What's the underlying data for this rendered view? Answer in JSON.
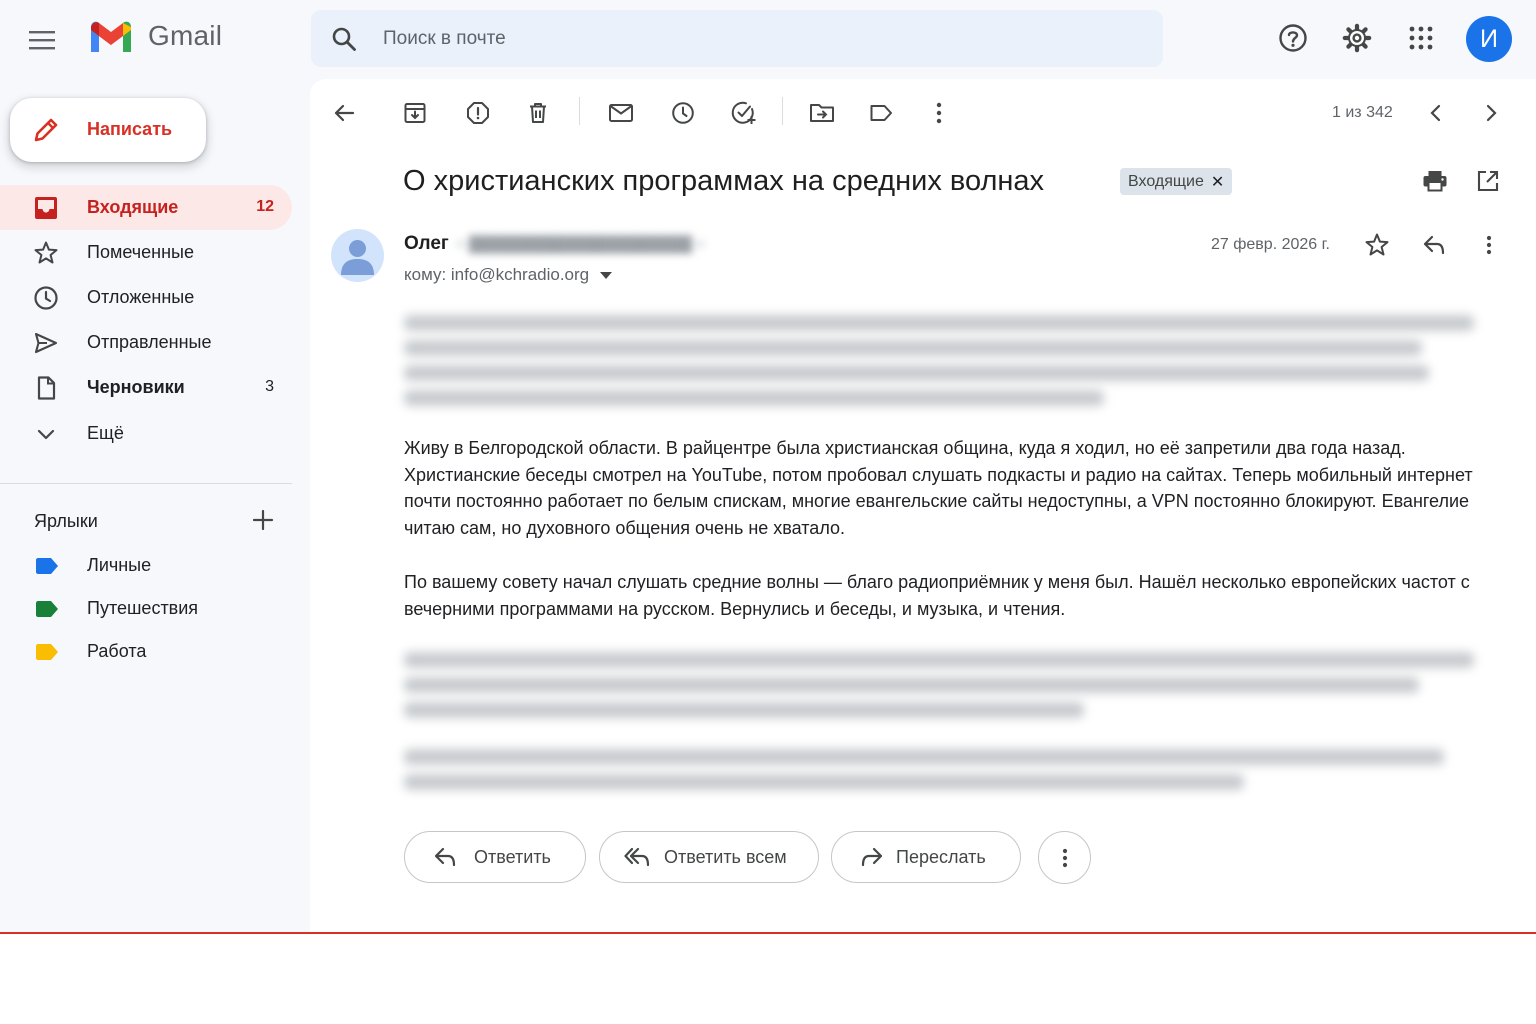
{
  "app": {
    "name": "Gmail",
    "accent": "#d93025",
    "brand_blue": "#1a73e8"
  },
  "header": {
    "search_placeholder": "Поиск в почте",
    "avatar_letter": "И"
  },
  "sidebar": {
    "compose_label": "Написать",
    "items": [
      {
        "label": "Входящие",
        "count": "12",
        "icon": "inbox-icon"
      },
      {
        "label": "Помеченные",
        "count": "",
        "icon": "star-icon"
      },
      {
        "label": "Отложенные",
        "count": "",
        "icon": "clock-icon"
      },
      {
        "label": "Отправленные",
        "count": "",
        "icon": "send-icon"
      },
      {
        "label": "Черновики",
        "count": "3",
        "icon": "file-icon"
      },
      {
        "label": "Ещё",
        "count": "",
        "icon": "chevron-down-icon"
      }
    ],
    "labels_title": "Ярлыки",
    "labels": [
      {
        "name": "Личные",
        "color": "#1a73e8"
      },
      {
        "name": "Путешествия",
        "color": "#188038"
      },
      {
        "name": "Работа",
        "color": "#fbbc04"
      }
    ]
  },
  "toolbar": {
    "pager": "1 из 342"
  },
  "message": {
    "subject": "О христианских программах на средних волнах",
    "label_chip": "Входящие",
    "sender_name": "Олег",
    "recipient": "кому: info@kchradio.org",
    "date": "27 февр. 2026 г.",
    "paragraph_1": "Живу в Белгородской области. В райцентре была христианская община, куда я ходил, но её запретили два года назад. Христианские беседы смотрел на YouTube, потом пробовал слушать подкасты и радио на сайтах. Теперь мобильный интернет почти постоянно работает по белым спискам, многие евангельские сайты недоступны, а VPN постоянно блокируют. Евангелие читаю сам, но духовного общения очень не хватало.",
    "paragraph_2": "По вашему совету начал слушать средние волны — благо радиоприёмник у меня был. Нашёл несколько европейских частот с вечерними программами на русском. Вернулись и беседы, и музыка, и чтения."
  },
  "actions": {
    "reply": "Ответить",
    "reply_all": "Ответить всем",
    "forward": "Переслать"
  }
}
